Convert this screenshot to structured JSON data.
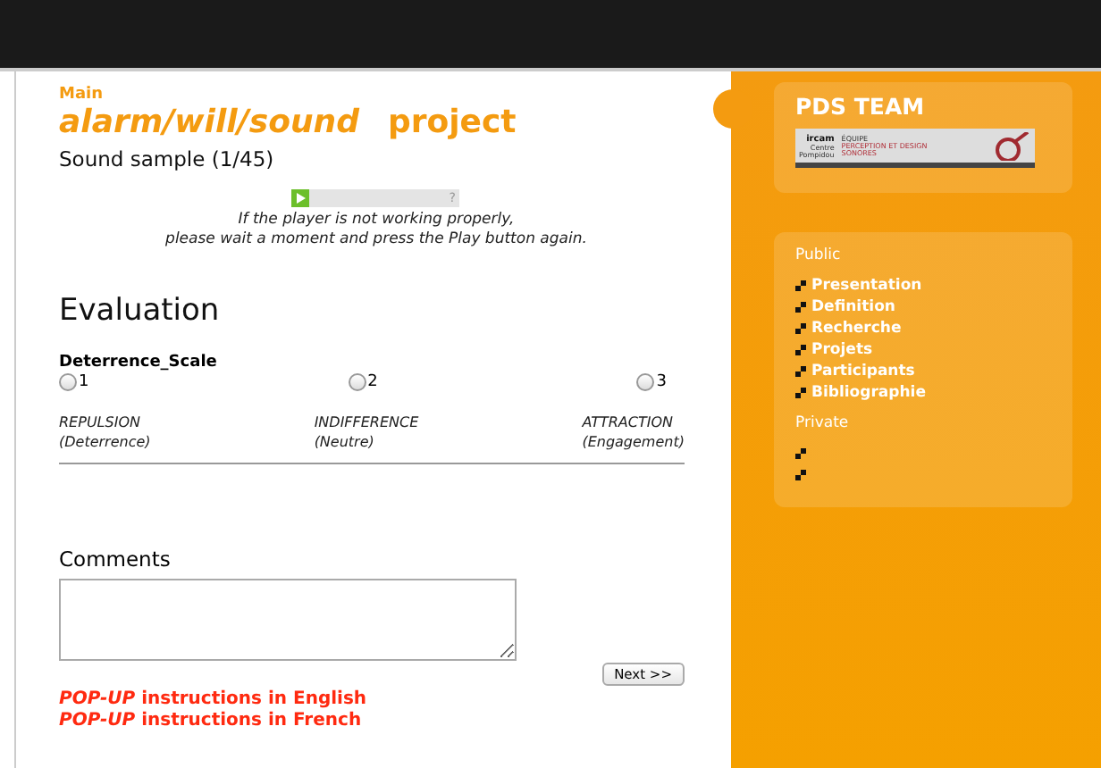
{
  "breadcrumb": "Main",
  "title": {
    "name": "alarm/will/sound",
    "suffix": "project"
  },
  "sample": "Sound sample (1/45)",
  "player": {
    "playing": false,
    "end_mark": "?"
  },
  "player_note": [
    "If the player is not working properly,",
    "please wait a moment and press the Play button again."
  ],
  "section": "Evaluation",
  "scale": {
    "name": "Deterrence_Scale",
    "options": [
      {
        "label": "1",
        "selected": false
      },
      {
        "label": "2",
        "selected": false
      },
      {
        "label": "3",
        "selected": false
      }
    ],
    "anchors": [
      {
        "term": "REPULSION",
        "gloss": "(Deterrence)"
      },
      {
        "term": "INDIFFERENCE",
        "gloss": "(Neutre)"
      },
      {
        "term": "ATTRACTION",
        "gloss": "(Engagement)"
      }
    ]
  },
  "comments": {
    "label": "Comments"
  },
  "next_button": "Next >>",
  "popups": [
    {
      "text": "*POP-UP* instructions in English"
    },
    {
      "text": "*POP-UP* instructions in French"
    }
  ],
  "sidebar": {
    "team": "PDS TEAM",
    "logo": {
      "org": "ircam",
      "sub": [
        "Centre",
        "Pompidou"
      ],
      "team_lines": [
        "ÉQUIPE",
        "PERCEPTION ET DESIGN",
        "SONORES"
      ]
    },
    "public": {
      "heading": "Public",
      "items": [
        {
          "kind": "link",
          "label": "Presentation"
        },
        {
          "kind": "link",
          "label": "Definition"
        },
        {
          "kind": "link",
          "label": "Recherche"
        },
        {
          "kind": "link",
          "label": "Projets"
        },
        {
          "kind": "link",
          "label": "Participants"
        },
        {
          "kind": "link",
          "label": "Bibliographie"
        }
      ]
    },
    "private": {
      "heading": "Private",
      "items": [
        {
          "kind": "empty"
        },
        {
          "kind": "empty"
        }
      ]
    }
  }
}
